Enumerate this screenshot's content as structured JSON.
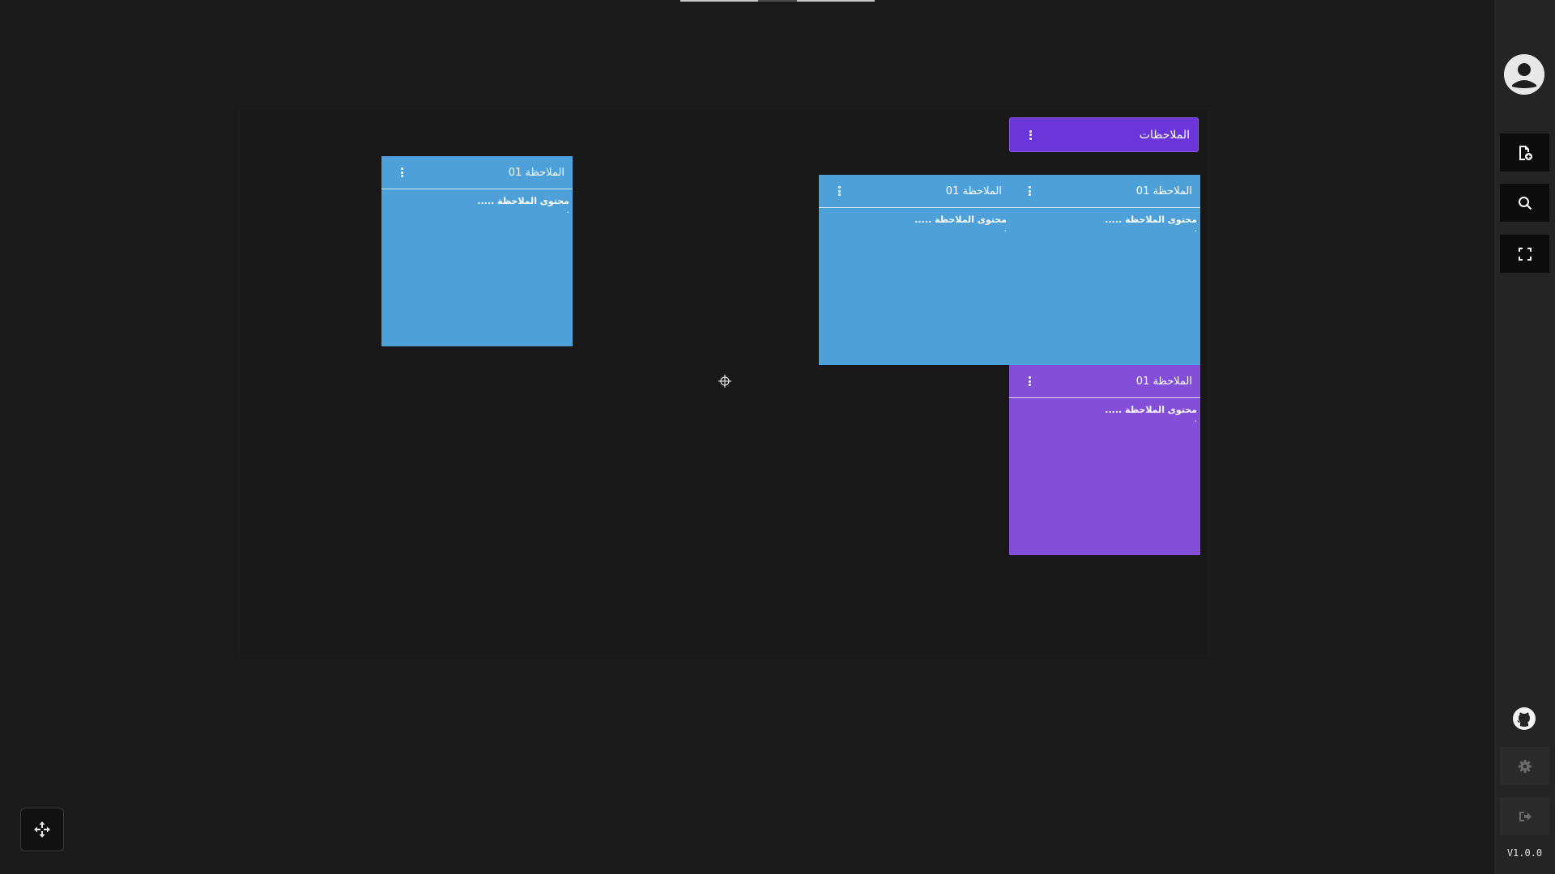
{
  "top_tabs": {
    "colors": [
      "#c8c8c8",
      "#4a4a4a",
      "#c8c8c8"
    ]
  },
  "notes_header": {
    "title": "الملاحظات",
    "menu_icon": "kebab-menu-icon",
    "color": "#6a35d9"
  },
  "notes": [
    {
      "title": "الملاحظة 01",
      "content": "محتوى الملاحظة .....",
      "extra": ".",
      "color": "#4da0d8"
    },
    {
      "title": "الملاحظة 01",
      "content": "محتوى الملاحظة .....",
      "extra": ".",
      "color": "#4da0d8"
    },
    {
      "title": "الملاحظة 01",
      "content": "محتوى الملاحظة .....",
      "extra": ".",
      "color": "#4da0d8"
    },
    {
      "title": "الملاحظة 01",
      "content": "محتوى الملاحظة .....",
      "extra": ".",
      "color": "#844fd8"
    }
  ],
  "sidebar": {
    "avatar_icon": "user-avatar-icon",
    "buttons": [
      {
        "icon": "add-note-icon"
      },
      {
        "icon": "search-icon"
      },
      {
        "icon": "fullscreen-icon"
      }
    ],
    "github_icon": "github-icon",
    "settings_icon": "gear-icon",
    "logout_icon": "logout-icon",
    "version": "V1.0.0"
  },
  "canvas": {
    "crosshair_icon": "crosshair-icon",
    "move_icon": "move-arrows-icon"
  }
}
